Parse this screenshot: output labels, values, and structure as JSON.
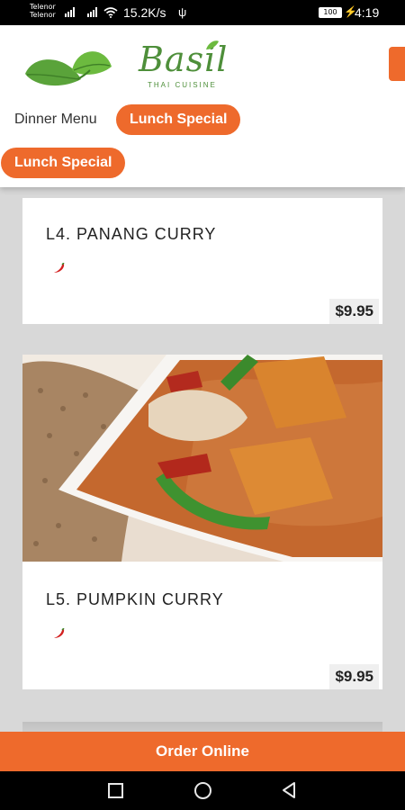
{
  "status_bar": {
    "carrier_1": "Telenor",
    "carrier_2": "Telenor",
    "net_speed": "15.2K/s",
    "battery": "100",
    "time": "4:19"
  },
  "header": {
    "logo_word": "Basil",
    "logo_subtitle": "THAI CUISINE"
  },
  "tabs": [
    {
      "label": "Dinner Menu"
    },
    {
      "label": "Lunch Special"
    }
  ],
  "category_chip": "Lunch Special",
  "menu_items": [
    {
      "name": "L4. PANANG CURRY",
      "price": "$9.95",
      "spicy": true
    },
    {
      "name": "L5. PUMPKIN CURRY",
      "price": "$9.95",
      "spicy": true
    }
  ],
  "order_button": "Order Online",
  "colors": {
    "accent": "#ee6a2c",
    "brand_green": "#4e8f3a"
  }
}
